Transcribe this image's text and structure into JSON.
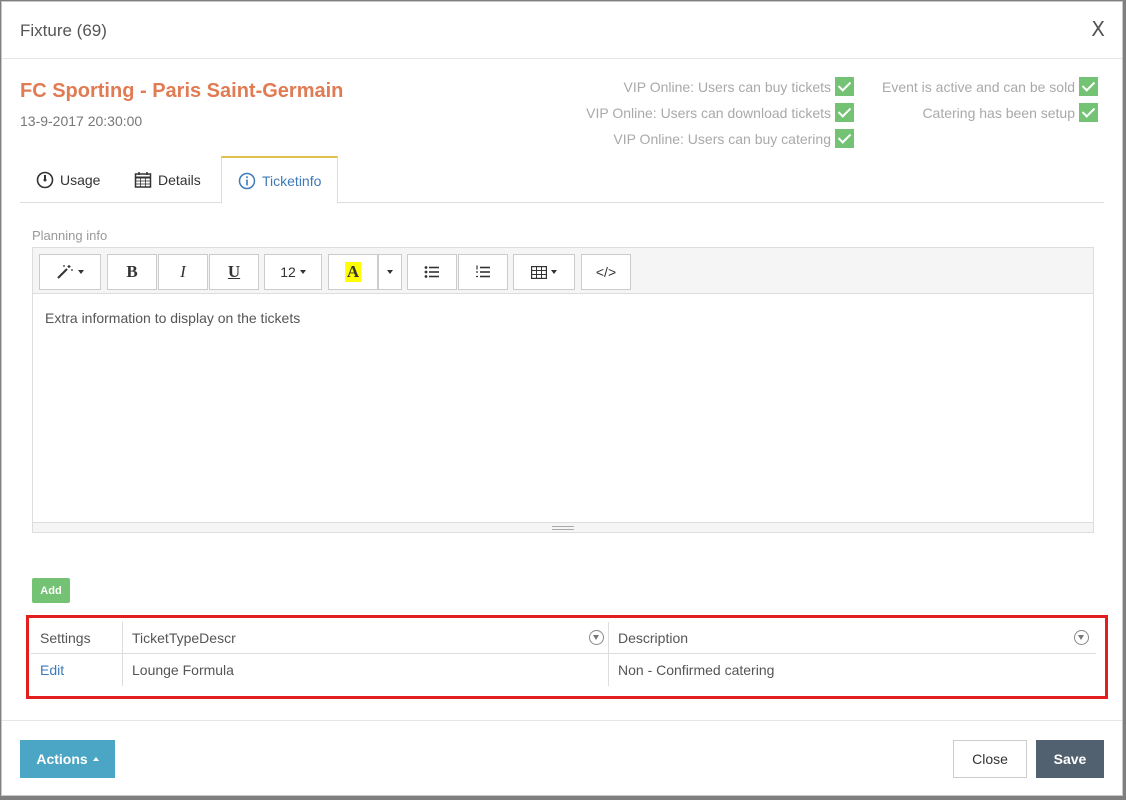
{
  "modal": {
    "title": "Fixture (69)",
    "close_label": "X"
  },
  "fixture": {
    "name": "FC Sporting - Paris Saint-Germain",
    "datetime": "13-9-2017 20:30:00"
  },
  "status_flags": [
    {
      "label": "VIP Online: Users can buy tickets",
      "checked": true
    },
    {
      "label": "VIP Online: Users can download tickets",
      "checked": true
    },
    {
      "label": "VIP Online: Users can buy catering",
      "checked": true
    },
    {
      "label": "Event is active and can be sold",
      "checked": true
    },
    {
      "label": "Catering has been setup",
      "checked": true
    }
  ],
  "tabs": [
    {
      "label": "Usage",
      "icon": "dashboard-icon",
      "active": false
    },
    {
      "label": "Details",
      "icon": "calendar-icon",
      "active": false
    },
    {
      "label": "Ticketinfo",
      "icon": "info-icon",
      "active": true
    }
  ],
  "planning": {
    "label": "Planning info",
    "toolbar": {
      "font_size": "12",
      "bold": "B",
      "italic": "I",
      "underline": "U",
      "highlight": "A",
      "code": "</>"
    },
    "content": "Extra information to display on the tickets"
  },
  "add_label": "Add",
  "grid": {
    "columns": [
      "Settings",
      "TicketTypeDescr",
      "Description"
    ],
    "rows": [
      {
        "settings": "Edit",
        "ticket_type": "Lounge Formula",
        "description": "Non - Confirmed catering"
      }
    ]
  },
  "footer": {
    "actions_label": "Actions",
    "close_label": "Close",
    "save_label": "Save"
  },
  "colors": {
    "accent": "#e07b53",
    "check": "#5cb85c",
    "highlight_border": "#e21e1e",
    "actions": "#4aa6c4",
    "save": "#526170"
  }
}
